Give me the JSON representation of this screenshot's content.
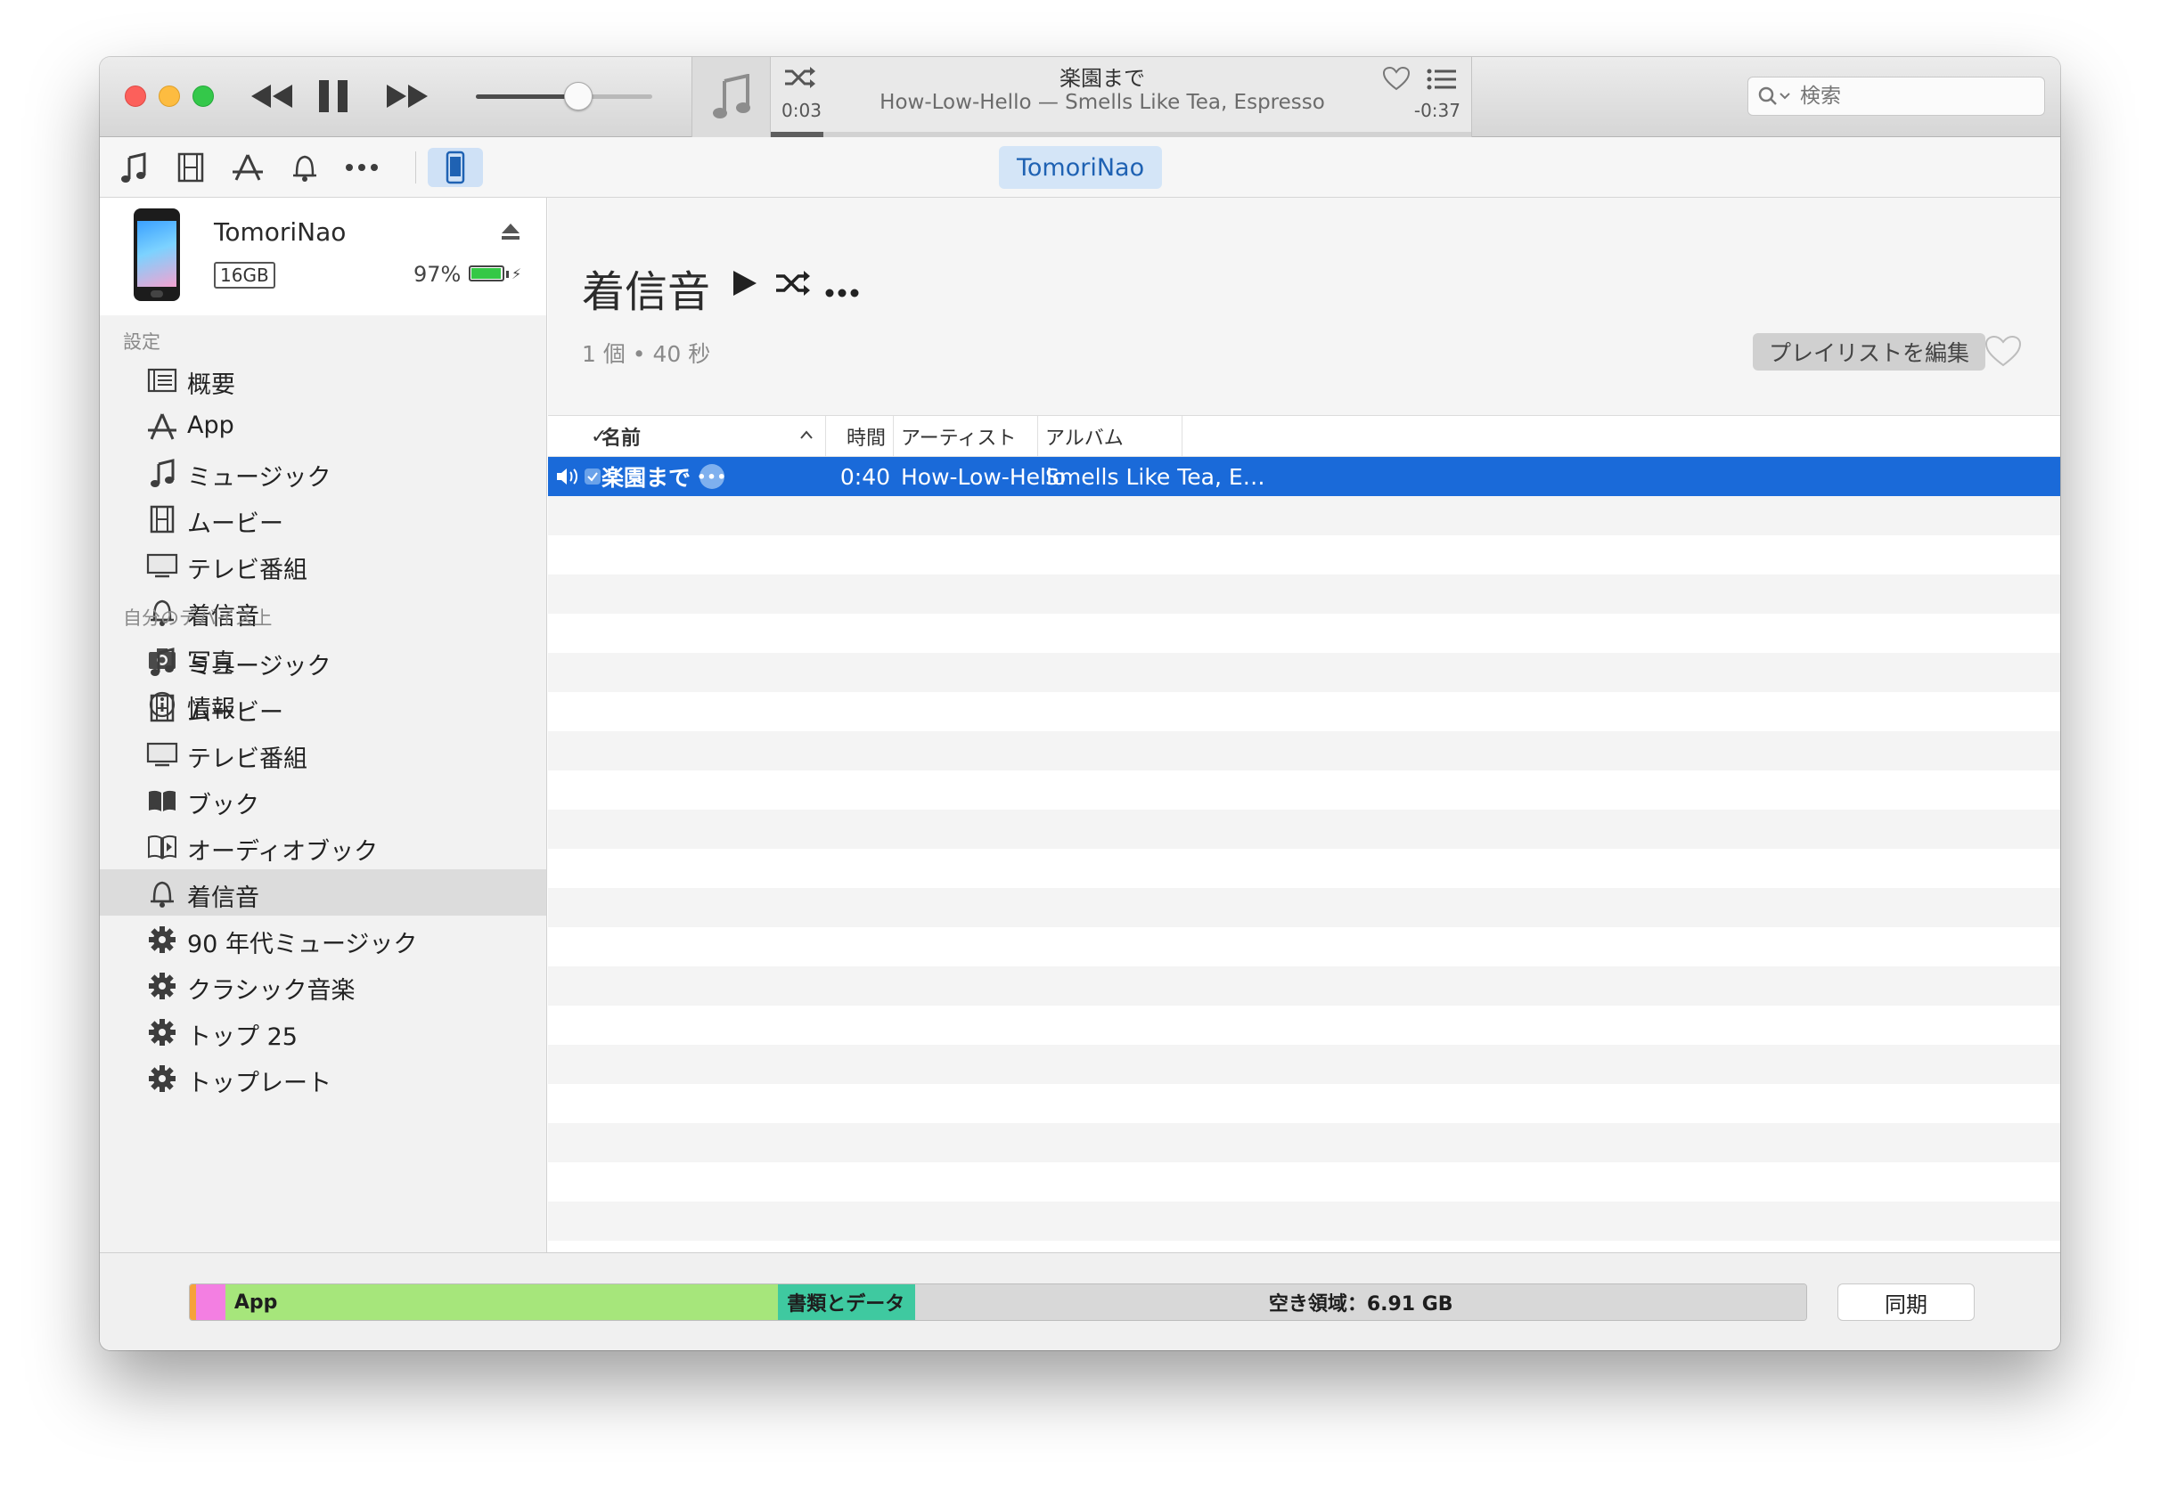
{
  "player": {
    "now_playing_title": "楽園まで",
    "now_playing_subtitle": "How-Low-Hello — Smells Like Tea, Espresso",
    "elapsed": "0:03",
    "remaining": "-0:37",
    "progress": 0.075,
    "volume": 0.58
  },
  "search": {
    "placeholder": "検索"
  },
  "toolbar": {
    "icons": [
      "music-icon",
      "film-icon",
      "app-store-icon",
      "bell-icon",
      "more-icon",
      "iphone-icon"
    ],
    "device_pill": "TomoriNao"
  },
  "device": {
    "name": "TomoriNao",
    "capacity": "16GB",
    "battery_pct": "97%",
    "battery_level": 0.97
  },
  "sidebar": {
    "settings_header": "設定",
    "settings_items": [
      {
        "label": "概要",
        "icon": "summary-icon"
      },
      {
        "label": "App",
        "icon": "app-store-icon"
      },
      {
        "label": "ミュージック",
        "icon": "music-note-icon"
      },
      {
        "label": "ムービー",
        "icon": "film-icon"
      },
      {
        "label": "テレビ番組",
        "icon": "tv-icon"
      },
      {
        "label": "着信音",
        "icon": "bell-icon"
      },
      {
        "label": "写真",
        "icon": "camera-icon"
      },
      {
        "label": "情報",
        "icon": "info-icon"
      }
    ],
    "device_header": "自分のデバイス上",
    "device_items": [
      {
        "label": "ミュージック",
        "icon": "music-note-icon"
      },
      {
        "label": "ムービー",
        "icon": "film-icon"
      },
      {
        "label": "テレビ番組",
        "icon": "tv-icon"
      },
      {
        "label": "ブック",
        "icon": "book-icon"
      },
      {
        "label": "オーディオブック",
        "icon": "audiobook-icon"
      },
      {
        "label": "着信音",
        "icon": "bell-icon",
        "selected": true
      },
      {
        "label": "90 年代ミュージック",
        "icon": "gear-icon"
      },
      {
        "label": "クラシック音楽",
        "icon": "gear-icon"
      },
      {
        "label": "トップ 25",
        "icon": "gear-icon"
      },
      {
        "label": "トップレート",
        "icon": "gear-icon"
      }
    ]
  },
  "playlist": {
    "title": "着信音",
    "stats": "1 個 • 40 秒",
    "edit_button": "プレイリストを編集"
  },
  "table": {
    "headers": {
      "check": "✓",
      "name": "名前",
      "time": "時間",
      "artist": "アーティスト",
      "album": "アルバム"
    },
    "rows": [
      {
        "name": "楽園まで",
        "time": "0:40",
        "artist": "How-Low-Hello",
        "album": "Smells Like Tea, E…",
        "playing": true,
        "checked": true
      }
    ]
  },
  "storage": {
    "app_label": "App",
    "docs_label": "書類とデータ",
    "free_label": "空き領域：6.91 GB",
    "segments": [
      {
        "name": "orange",
        "fraction": 0.004,
        "color": "#f6a23a"
      },
      {
        "name": "pink",
        "fraction": 0.018,
        "color": "#f37fe2"
      },
      {
        "name": "app",
        "fraction": 0.342,
        "color": "#a6e67b"
      },
      {
        "name": "docs",
        "fraction": 0.085,
        "color": "#3fc9a0"
      },
      {
        "name": "free",
        "fraction": 0.551,
        "color": "#d8d8d8"
      }
    ],
    "sync_button": "同期"
  }
}
